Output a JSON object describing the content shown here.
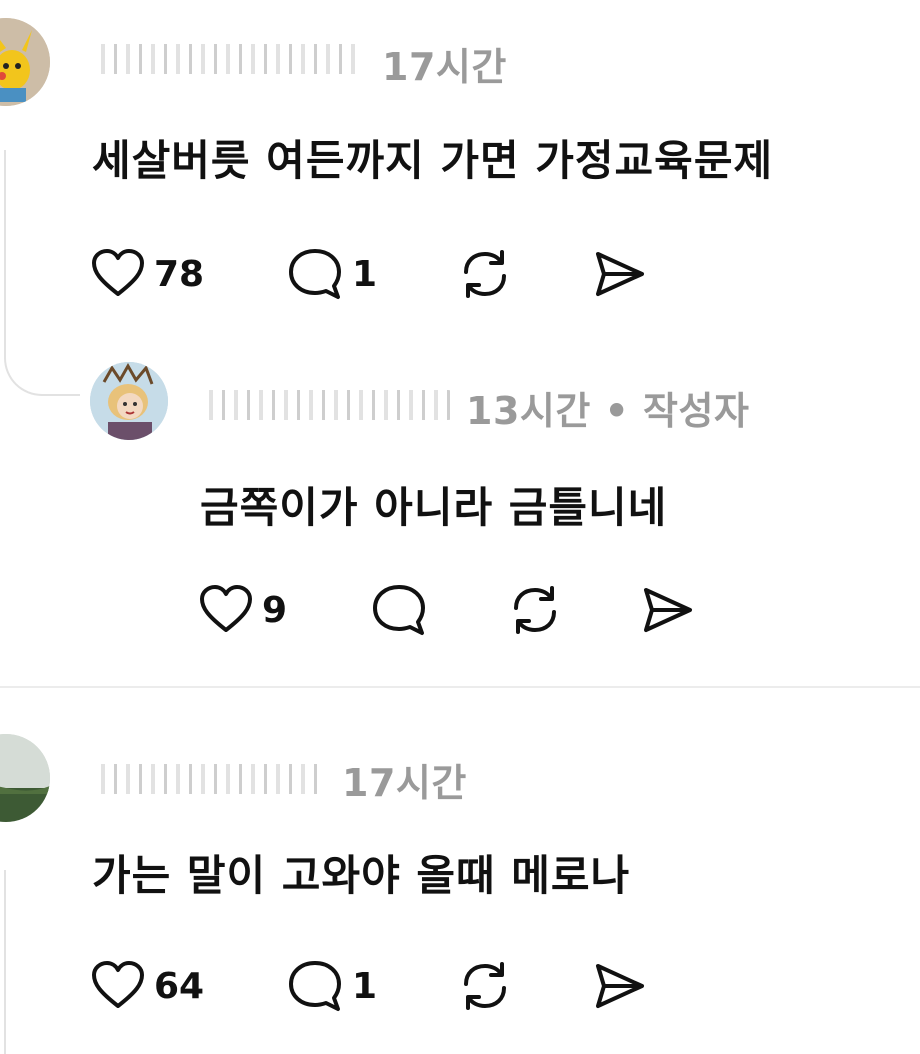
{
  "comments": [
    {
      "time": "17시간",
      "text": "세살버릇 여든까지 가면 가정교육문제",
      "likes": "78",
      "replies": "1",
      "avatar_icon": "pikachu-avatar-icon"
    },
    {
      "time": "13시간 • 작성자",
      "text": "금쪽이가 아니라 금틀니네",
      "likes": "9",
      "replies": "",
      "avatar_icon": "cartoon-girl-avatar-icon"
    },
    {
      "time": "17시간",
      "text": "가는 말이 고와야 올때 메로나",
      "likes": "64",
      "replies": "1",
      "avatar_icon": "landscape-avatar-icon"
    }
  ],
  "colors": {
    "text": "#111111",
    "meta": "#9a9a9a",
    "divider": "#ececec",
    "thread_line": "#e2e2e2"
  },
  "icons": [
    "heart-icon",
    "comment-bubble-icon",
    "repost-icon",
    "share-send-icon"
  ]
}
